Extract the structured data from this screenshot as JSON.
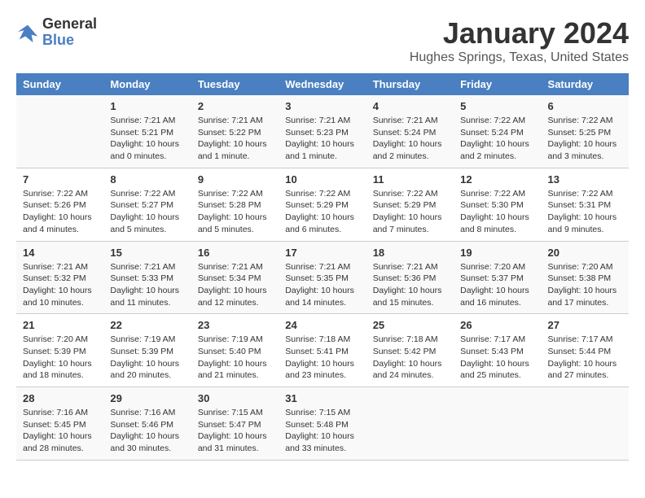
{
  "header": {
    "logo_line1": "General",
    "logo_line2": "Blue",
    "month": "January 2024",
    "location": "Hughes Springs, Texas, United States"
  },
  "days_of_week": [
    "Sunday",
    "Monday",
    "Tuesday",
    "Wednesday",
    "Thursday",
    "Friday",
    "Saturday"
  ],
  "weeks": [
    [
      {
        "day": "",
        "info": ""
      },
      {
        "day": "1",
        "info": "Sunrise: 7:21 AM\nSunset: 5:21 PM\nDaylight: 10 hours\nand 0 minutes."
      },
      {
        "day": "2",
        "info": "Sunrise: 7:21 AM\nSunset: 5:22 PM\nDaylight: 10 hours\nand 1 minute."
      },
      {
        "day": "3",
        "info": "Sunrise: 7:21 AM\nSunset: 5:23 PM\nDaylight: 10 hours\nand 1 minute."
      },
      {
        "day": "4",
        "info": "Sunrise: 7:21 AM\nSunset: 5:24 PM\nDaylight: 10 hours\nand 2 minutes."
      },
      {
        "day": "5",
        "info": "Sunrise: 7:22 AM\nSunset: 5:24 PM\nDaylight: 10 hours\nand 2 minutes."
      },
      {
        "day": "6",
        "info": "Sunrise: 7:22 AM\nSunset: 5:25 PM\nDaylight: 10 hours\nand 3 minutes."
      }
    ],
    [
      {
        "day": "7",
        "info": "Sunrise: 7:22 AM\nSunset: 5:26 PM\nDaylight: 10 hours\nand 4 minutes."
      },
      {
        "day": "8",
        "info": "Sunrise: 7:22 AM\nSunset: 5:27 PM\nDaylight: 10 hours\nand 5 minutes."
      },
      {
        "day": "9",
        "info": "Sunrise: 7:22 AM\nSunset: 5:28 PM\nDaylight: 10 hours\nand 5 minutes."
      },
      {
        "day": "10",
        "info": "Sunrise: 7:22 AM\nSunset: 5:29 PM\nDaylight: 10 hours\nand 6 minutes."
      },
      {
        "day": "11",
        "info": "Sunrise: 7:22 AM\nSunset: 5:29 PM\nDaylight: 10 hours\nand 7 minutes."
      },
      {
        "day": "12",
        "info": "Sunrise: 7:22 AM\nSunset: 5:30 PM\nDaylight: 10 hours\nand 8 minutes."
      },
      {
        "day": "13",
        "info": "Sunrise: 7:22 AM\nSunset: 5:31 PM\nDaylight: 10 hours\nand 9 minutes."
      }
    ],
    [
      {
        "day": "14",
        "info": "Sunrise: 7:21 AM\nSunset: 5:32 PM\nDaylight: 10 hours\nand 10 minutes."
      },
      {
        "day": "15",
        "info": "Sunrise: 7:21 AM\nSunset: 5:33 PM\nDaylight: 10 hours\nand 11 minutes."
      },
      {
        "day": "16",
        "info": "Sunrise: 7:21 AM\nSunset: 5:34 PM\nDaylight: 10 hours\nand 12 minutes."
      },
      {
        "day": "17",
        "info": "Sunrise: 7:21 AM\nSunset: 5:35 PM\nDaylight: 10 hours\nand 14 minutes."
      },
      {
        "day": "18",
        "info": "Sunrise: 7:21 AM\nSunset: 5:36 PM\nDaylight: 10 hours\nand 15 minutes."
      },
      {
        "day": "19",
        "info": "Sunrise: 7:20 AM\nSunset: 5:37 PM\nDaylight: 10 hours\nand 16 minutes."
      },
      {
        "day": "20",
        "info": "Sunrise: 7:20 AM\nSunset: 5:38 PM\nDaylight: 10 hours\nand 17 minutes."
      }
    ],
    [
      {
        "day": "21",
        "info": "Sunrise: 7:20 AM\nSunset: 5:39 PM\nDaylight: 10 hours\nand 18 minutes."
      },
      {
        "day": "22",
        "info": "Sunrise: 7:19 AM\nSunset: 5:39 PM\nDaylight: 10 hours\nand 20 minutes."
      },
      {
        "day": "23",
        "info": "Sunrise: 7:19 AM\nSunset: 5:40 PM\nDaylight: 10 hours\nand 21 minutes."
      },
      {
        "day": "24",
        "info": "Sunrise: 7:18 AM\nSunset: 5:41 PM\nDaylight: 10 hours\nand 23 minutes."
      },
      {
        "day": "25",
        "info": "Sunrise: 7:18 AM\nSunset: 5:42 PM\nDaylight: 10 hours\nand 24 minutes."
      },
      {
        "day": "26",
        "info": "Sunrise: 7:17 AM\nSunset: 5:43 PM\nDaylight: 10 hours\nand 25 minutes."
      },
      {
        "day": "27",
        "info": "Sunrise: 7:17 AM\nSunset: 5:44 PM\nDaylight: 10 hours\nand 27 minutes."
      }
    ],
    [
      {
        "day": "28",
        "info": "Sunrise: 7:16 AM\nSunset: 5:45 PM\nDaylight: 10 hours\nand 28 minutes."
      },
      {
        "day": "29",
        "info": "Sunrise: 7:16 AM\nSunset: 5:46 PM\nDaylight: 10 hours\nand 30 minutes."
      },
      {
        "day": "30",
        "info": "Sunrise: 7:15 AM\nSunset: 5:47 PM\nDaylight: 10 hours\nand 31 minutes."
      },
      {
        "day": "31",
        "info": "Sunrise: 7:15 AM\nSunset: 5:48 PM\nDaylight: 10 hours\nand 33 minutes."
      },
      {
        "day": "",
        "info": ""
      },
      {
        "day": "",
        "info": ""
      },
      {
        "day": "",
        "info": ""
      }
    ]
  ]
}
